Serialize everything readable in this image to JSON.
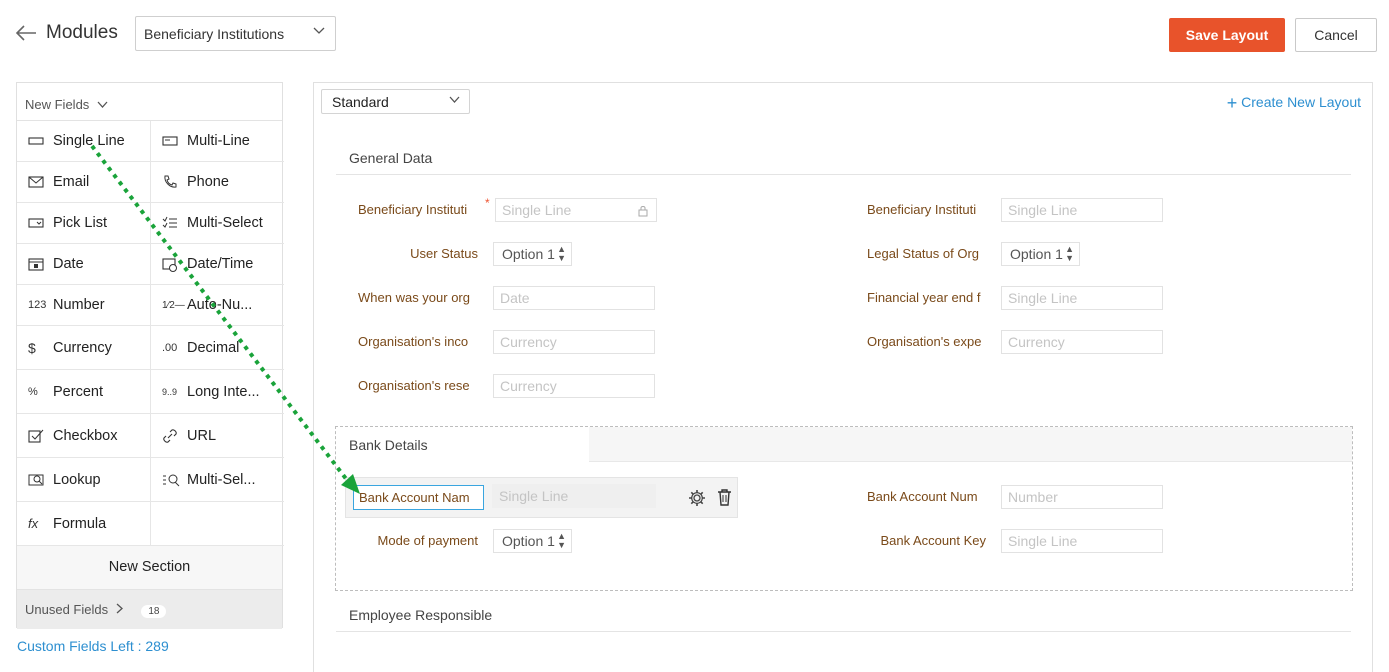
{
  "header": {
    "title": "Modules",
    "module_select": "Beneficiary Institutions",
    "save_label": "Save Layout",
    "cancel_label": "Cancel"
  },
  "palette": {
    "header": "New Fields",
    "fields": [
      {
        "label": "Single Line",
        "icon": "single-line-icon"
      },
      {
        "label": "Multi-Line",
        "icon": "multi-line-icon"
      },
      {
        "label": "Email",
        "icon": "email-icon"
      },
      {
        "label": "Phone",
        "icon": "phone-icon"
      },
      {
        "label": "Pick List",
        "icon": "pick-list-icon"
      },
      {
        "label": "Multi-Select",
        "icon": "multi-select-icon"
      },
      {
        "label": "Date",
        "icon": "date-icon"
      },
      {
        "label": "Date/Time",
        "icon": "date-time-icon"
      },
      {
        "label": "Number",
        "icon": "number-icon"
      },
      {
        "label": "Auto-Nu...",
        "icon": "auto-number-icon"
      },
      {
        "label": "Currency",
        "icon": "currency-icon"
      },
      {
        "label": "Decimal",
        "icon": "decimal-icon"
      },
      {
        "label": "Percent",
        "icon": "percent-icon"
      },
      {
        "label": "Long Inte...",
        "icon": "long-integer-icon"
      },
      {
        "label": "Checkbox",
        "icon": "checkbox-icon"
      },
      {
        "label": "URL",
        "icon": "url-icon"
      },
      {
        "label": "Lookup",
        "icon": "lookup-icon"
      },
      {
        "label": "Multi-Sel...",
        "icon": "multi-select-lookup-icon"
      },
      {
        "label": "Formula",
        "icon": "formula-icon"
      },
      {
        "label": "",
        "icon": ""
      }
    ],
    "new_section": "New Section",
    "unused_label": "Unused Fields",
    "unused_count": "18",
    "custom_fields_left": "Custom Fields Left : 289"
  },
  "canvas": {
    "layout_select": "Standard",
    "create_layout": "Create New Layout",
    "sections": {
      "general": "General Data",
      "bank": "Bank Details",
      "employee": "Employee Responsible"
    },
    "general_fields": {
      "beneficiary_left_label": "Beneficiary Instituti",
      "beneficiary_left_placeholder": "Single Line",
      "beneficiary_right_label": "Beneficiary Instituti",
      "beneficiary_right_placeholder": "Single Line",
      "user_status_label": "User Status",
      "user_status_value": "Option 1",
      "legal_status_label": "Legal Status of Org",
      "legal_status_value": "Option 1",
      "when_label": "When was your org",
      "when_placeholder": "Date",
      "fy_label": "Financial year end f",
      "fy_placeholder": "Single Line",
      "income_label": "Organisation's inco",
      "income_placeholder": "Currency",
      "expense_label": "Organisation's expe",
      "expense_placeholder": "Currency",
      "reserve_label": "Organisation's rese",
      "reserve_placeholder": "Currency"
    },
    "bank_fields": {
      "account_name_label": "Bank Account Nam",
      "account_name_placeholder": "Single Line",
      "account_num_label": "Bank Account Num",
      "account_num_placeholder": "Number",
      "mode_label": "Mode of payment",
      "mode_value": "Option 1",
      "account_key_label": "Bank Account Key",
      "account_key_placeholder": "Single Line"
    }
  },
  "colors": {
    "accent_orange": "#e8532b",
    "link_blue": "#2d8fd0",
    "label_brown": "#7a4a1a",
    "drag_arrow_green": "#1aa33a"
  }
}
